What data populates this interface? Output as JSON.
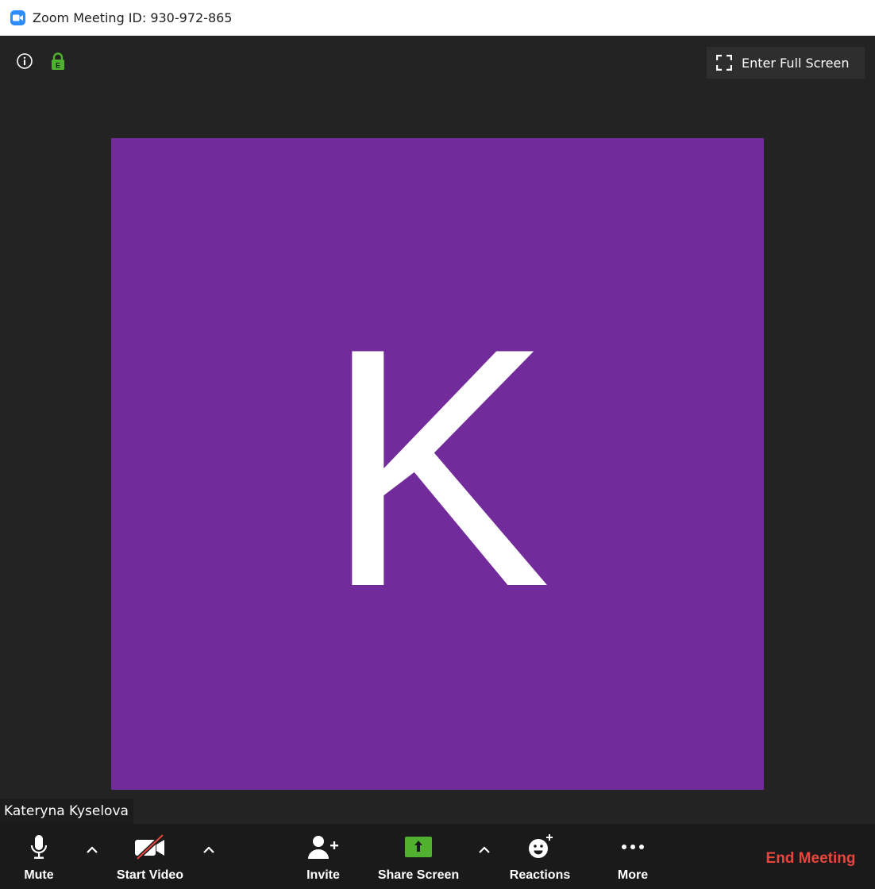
{
  "window": {
    "title": "Zoom Meeting ID: 930-972-865",
    "app_icon": "zoom-camera-icon"
  },
  "header": {
    "fullscreen_label": "Enter Full Screen",
    "info_icon": "info-icon",
    "lock_icon": "encryption-lock-icon",
    "lock_letter": "E"
  },
  "video": {
    "avatar_letter": "K",
    "avatar_color": "#722b9a",
    "participant_name": "Kateryna Kyselova"
  },
  "toolbar": {
    "items": [
      {
        "label": "Mute",
        "icon": "microphone-icon"
      },
      {
        "label": "Start Video",
        "icon": "video-off-icon"
      },
      {
        "label": "Invite",
        "icon": "add-person-icon"
      },
      {
        "label": "Share Screen",
        "icon": "share-screen-icon"
      },
      {
        "label": "Reactions",
        "icon": "reaction-emoji-icon"
      },
      {
        "label": "More",
        "icon": "more-dots-icon"
      }
    ],
    "end_meeting_label": "End Meeting"
  },
  "colors": {
    "background": "#232323",
    "toolbar": "#1a1a1a",
    "accent_blue": "#2d8cff",
    "lock_green": "#4fb12f",
    "share_green": "#4fb12f",
    "end_red": "#e8453c"
  }
}
